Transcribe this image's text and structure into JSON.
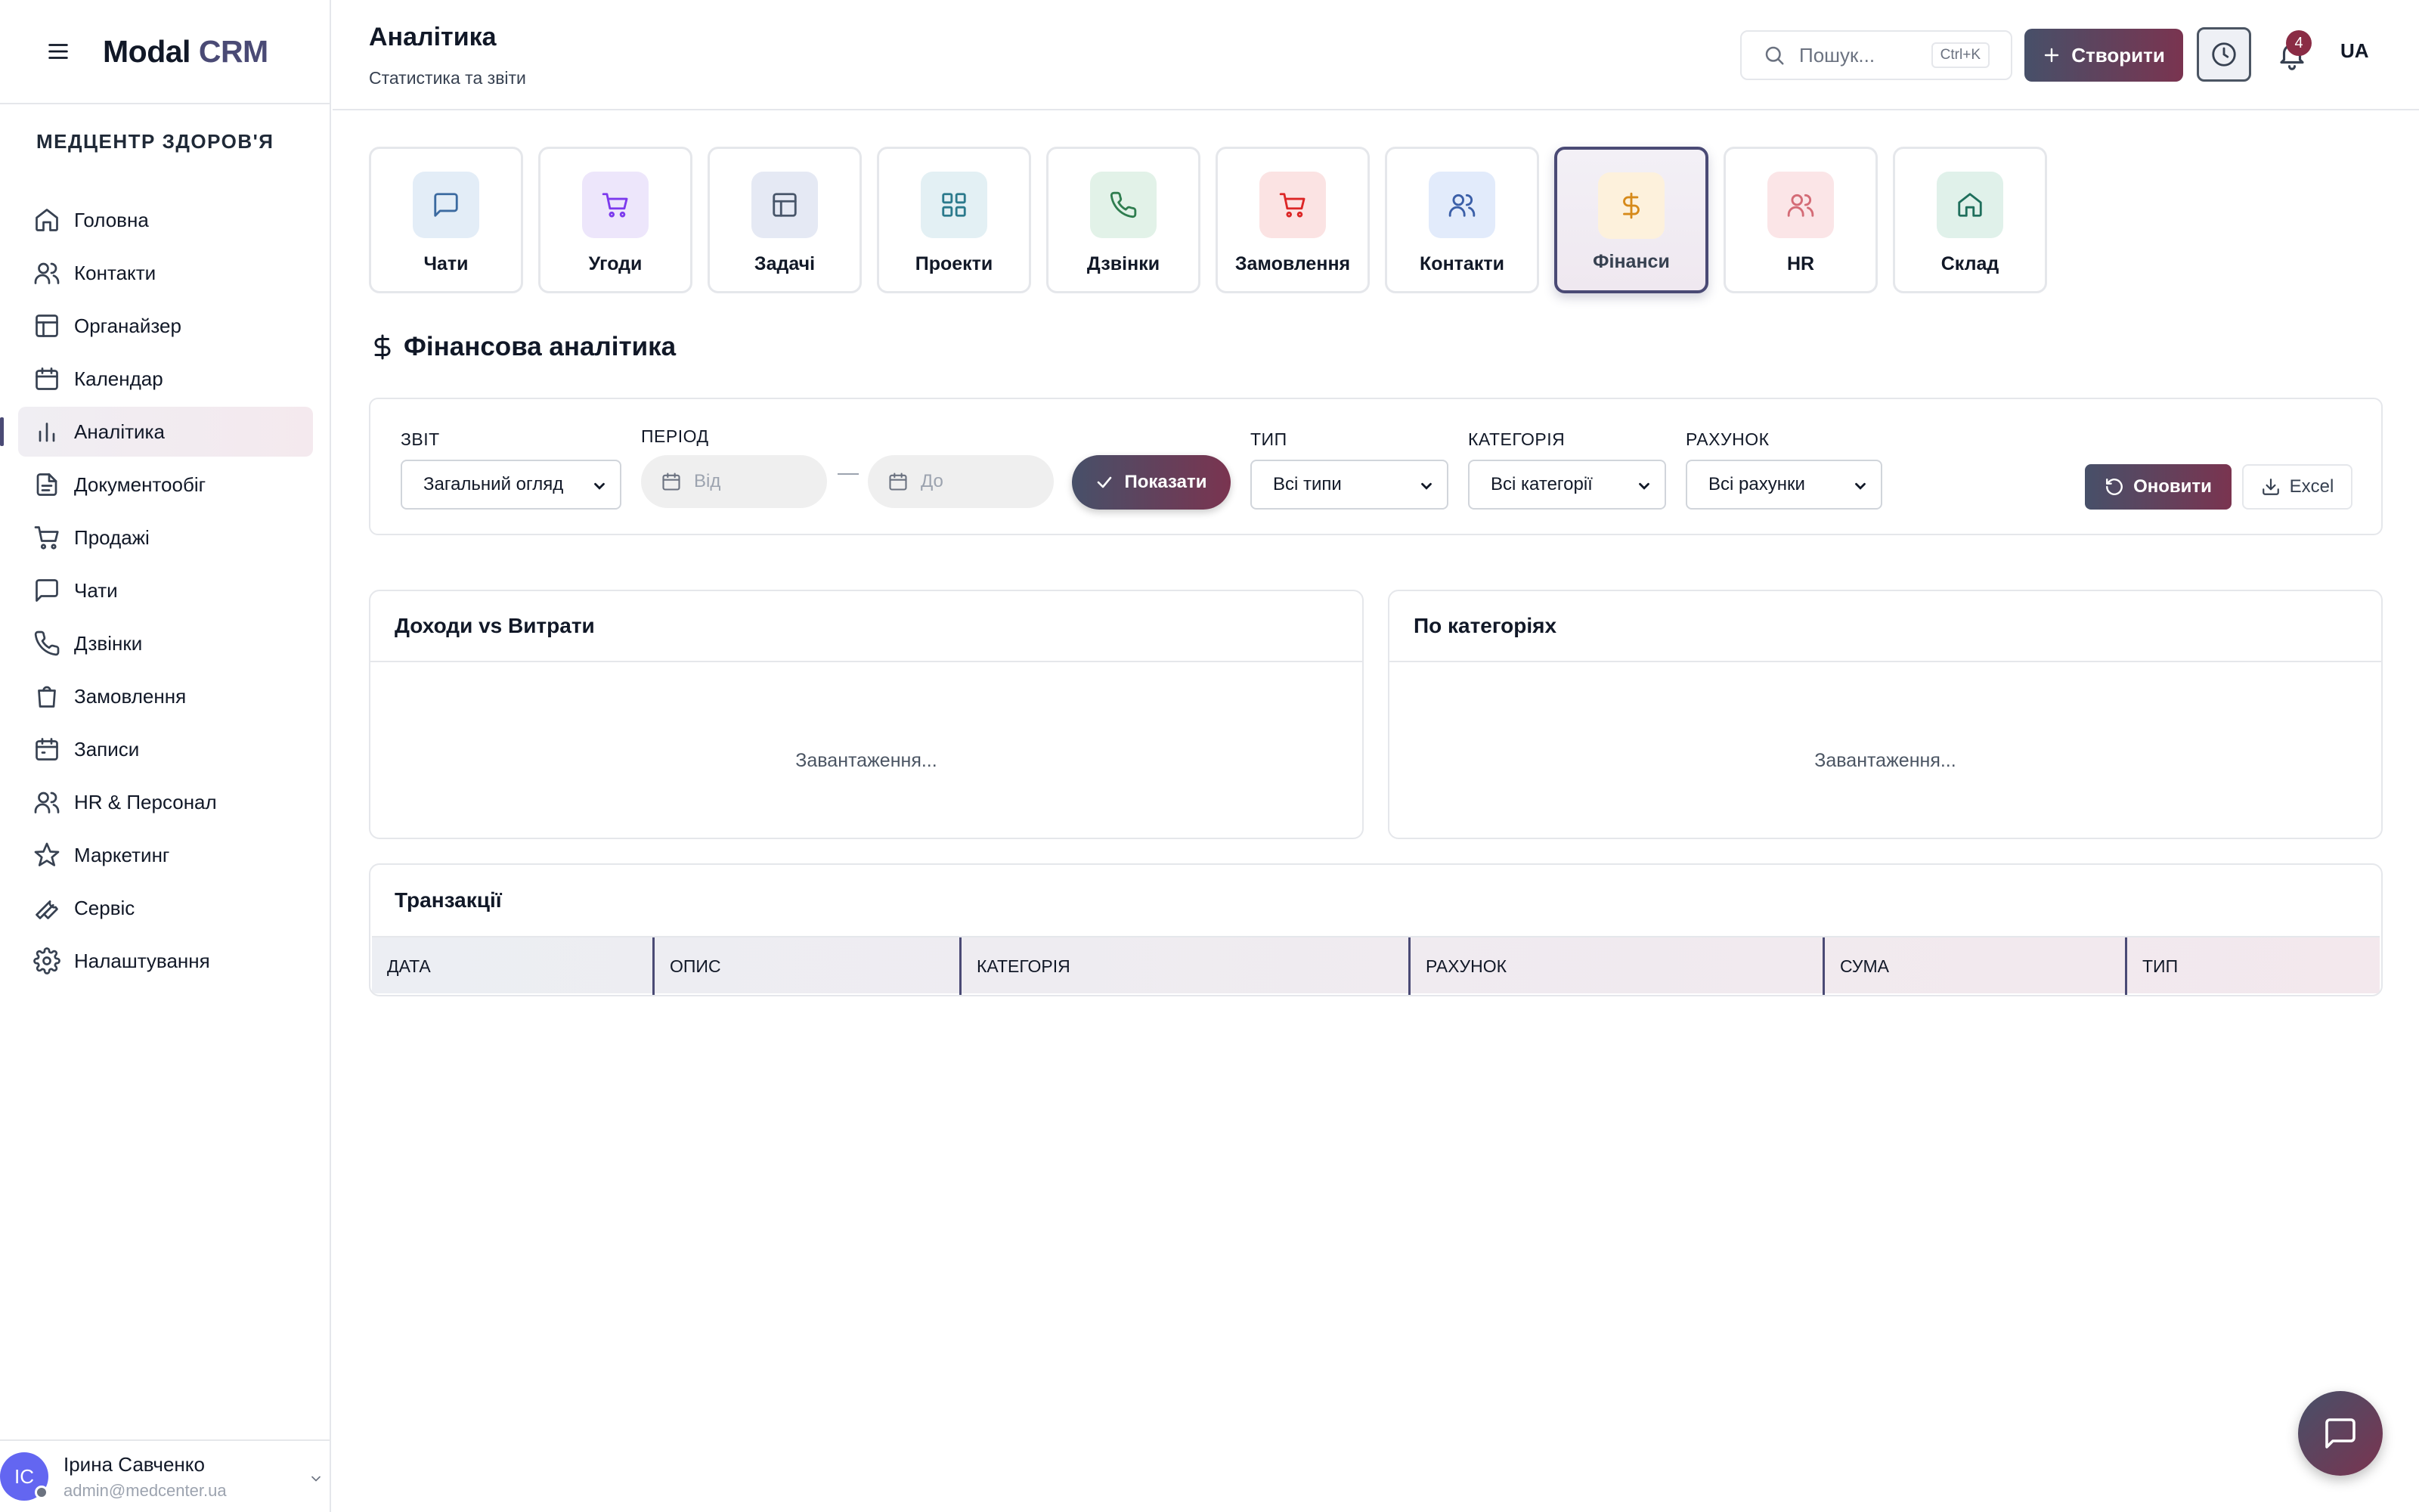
{
  "app": {
    "logo_main": "Modal",
    "logo_accent": "CRM"
  },
  "sidebar": {
    "org_name": "МЕДЦЕНТР ЗДОРОВ'Я",
    "items": [
      {
        "label": "Головна",
        "icon": "home-icon"
      },
      {
        "label": "Контакти",
        "icon": "users-icon"
      },
      {
        "label": "Органайзер",
        "icon": "layout-icon"
      },
      {
        "label": "Календар",
        "icon": "calendar-icon"
      },
      {
        "label": "Аналітика",
        "icon": "bar-chart-icon",
        "active": true
      },
      {
        "label": "Документообіг",
        "icon": "file-icon"
      },
      {
        "label": "Продажі",
        "icon": "cart-icon"
      },
      {
        "label": "Чати",
        "icon": "chat-icon"
      },
      {
        "label": "Дзвінки",
        "icon": "phone-icon"
      },
      {
        "label": "Замовлення",
        "icon": "shopping-bag-icon"
      },
      {
        "label": "Записи",
        "icon": "calendar-check-icon"
      },
      {
        "label": "HR & Персонал",
        "icon": "users-icon"
      },
      {
        "label": "Маркетинг",
        "icon": "star-icon"
      },
      {
        "label": "Сервіс",
        "icon": "wrench-icon"
      },
      {
        "label": "Налаштування",
        "icon": "gear-icon"
      }
    ],
    "user": {
      "initials": "IC",
      "name": "Ірина Савченко",
      "email": "admin@medcenter.ua"
    }
  },
  "header": {
    "title": "Аналітика",
    "subtitle": "Статистика та звіти",
    "search_placeholder": "Пошук...",
    "search_shortcut": "Ctrl+K",
    "create_label": "Створити",
    "notification_count": "4",
    "language": "UA"
  },
  "modules": [
    {
      "label": "Чати",
      "icon": "chat-icon",
      "bg": "#e3edf7",
      "color": "#3b6aa0"
    },
    {
      "label": "Угоди",
      "icon": "cart-icon",
      "bg": "#ede6fb",
      "color": "#7c3aed"
    },
    {
      "label": "Задачі",
      "icon": "layout-icon",
      "bg": "#e5e9f4",
      "color": "#475569"
    },
    {
      "label": "Проекти",
      "icon": "grid-icon",
      "bg": "#e3f0f4",
      "color": "#2b7a8c"
    },
    {
      "label": "Дзвінки",
      "icon": "phone-icon",
      "bg": "#e2f2e8",
      "color": "#2f7d4f"
    },
    {
      "label": "Замовлення",
      "icon": "cart-icon",
      "bg": "#fbe3e3",
      "color": "#dc2626"
    },
    {
      "label": "Контакти",
      "icon": "users-icon",
      "bg": "#e2ebfb",
      "color": "#3b5fa8"
    },
    {
      "label": "Фінанси",
      "icon": "dollar-icon",
      "bg": "#fdf1dc",
      "color": "#d68a1a",
      "active": true
    },
    {
      "label": "HR",
      "icon": "users-icon",
      "bg": "#fbe5e7",
      "color": "#d46b76"
    },
    {
      "label": "Склад",
      "icon": "home-icon",
      "bg": "#e0f1ea",
      "color": "#1f6f5c"
    }
  ],
  "section": {
    "title": "Фінансова аналітика",
    "icon": "dollar-icon"
  },
  "filters": {
    "report_label": "ЗВІТ",
    "report_value": "Загальний огляд",
    "period_label": "ПЕРІОД",
    "from_placeholder": "Від",
    "to_placeholder": "До",
    "show_label": "Показати",
    "type_label": "ТИП",
    "type_value": "Всі типи",
    "category_label": "КАТЕГОРІЯ",
    "category_value": "Всі категорії",
    "account_label": "РАХУНОК",
    "account_value": "Всі рахунки",
    "refresh_label": "Оновити",
    "excel_label": "Excel"
  },
  "panels": {
    "income_title": "Доходи vs Витрати",
    "income_loading": "Завантаження...",
    "category_title": "По категоріях",
    "category_loading": "Завантаження..."
  },
  "transactions": {
    "title": "Транзакції",
    "columns": [
      "ДАТА",
      "ОПИС",
      "КАТЕГОРІЯ",
      "РАХУНОК",
      "СУМА",
      "ТИП"
    ]
  },
  "colors": {
    "accent": "#4a4a75",
    "accent_gradient_end": "#7a3450"
  }
}
